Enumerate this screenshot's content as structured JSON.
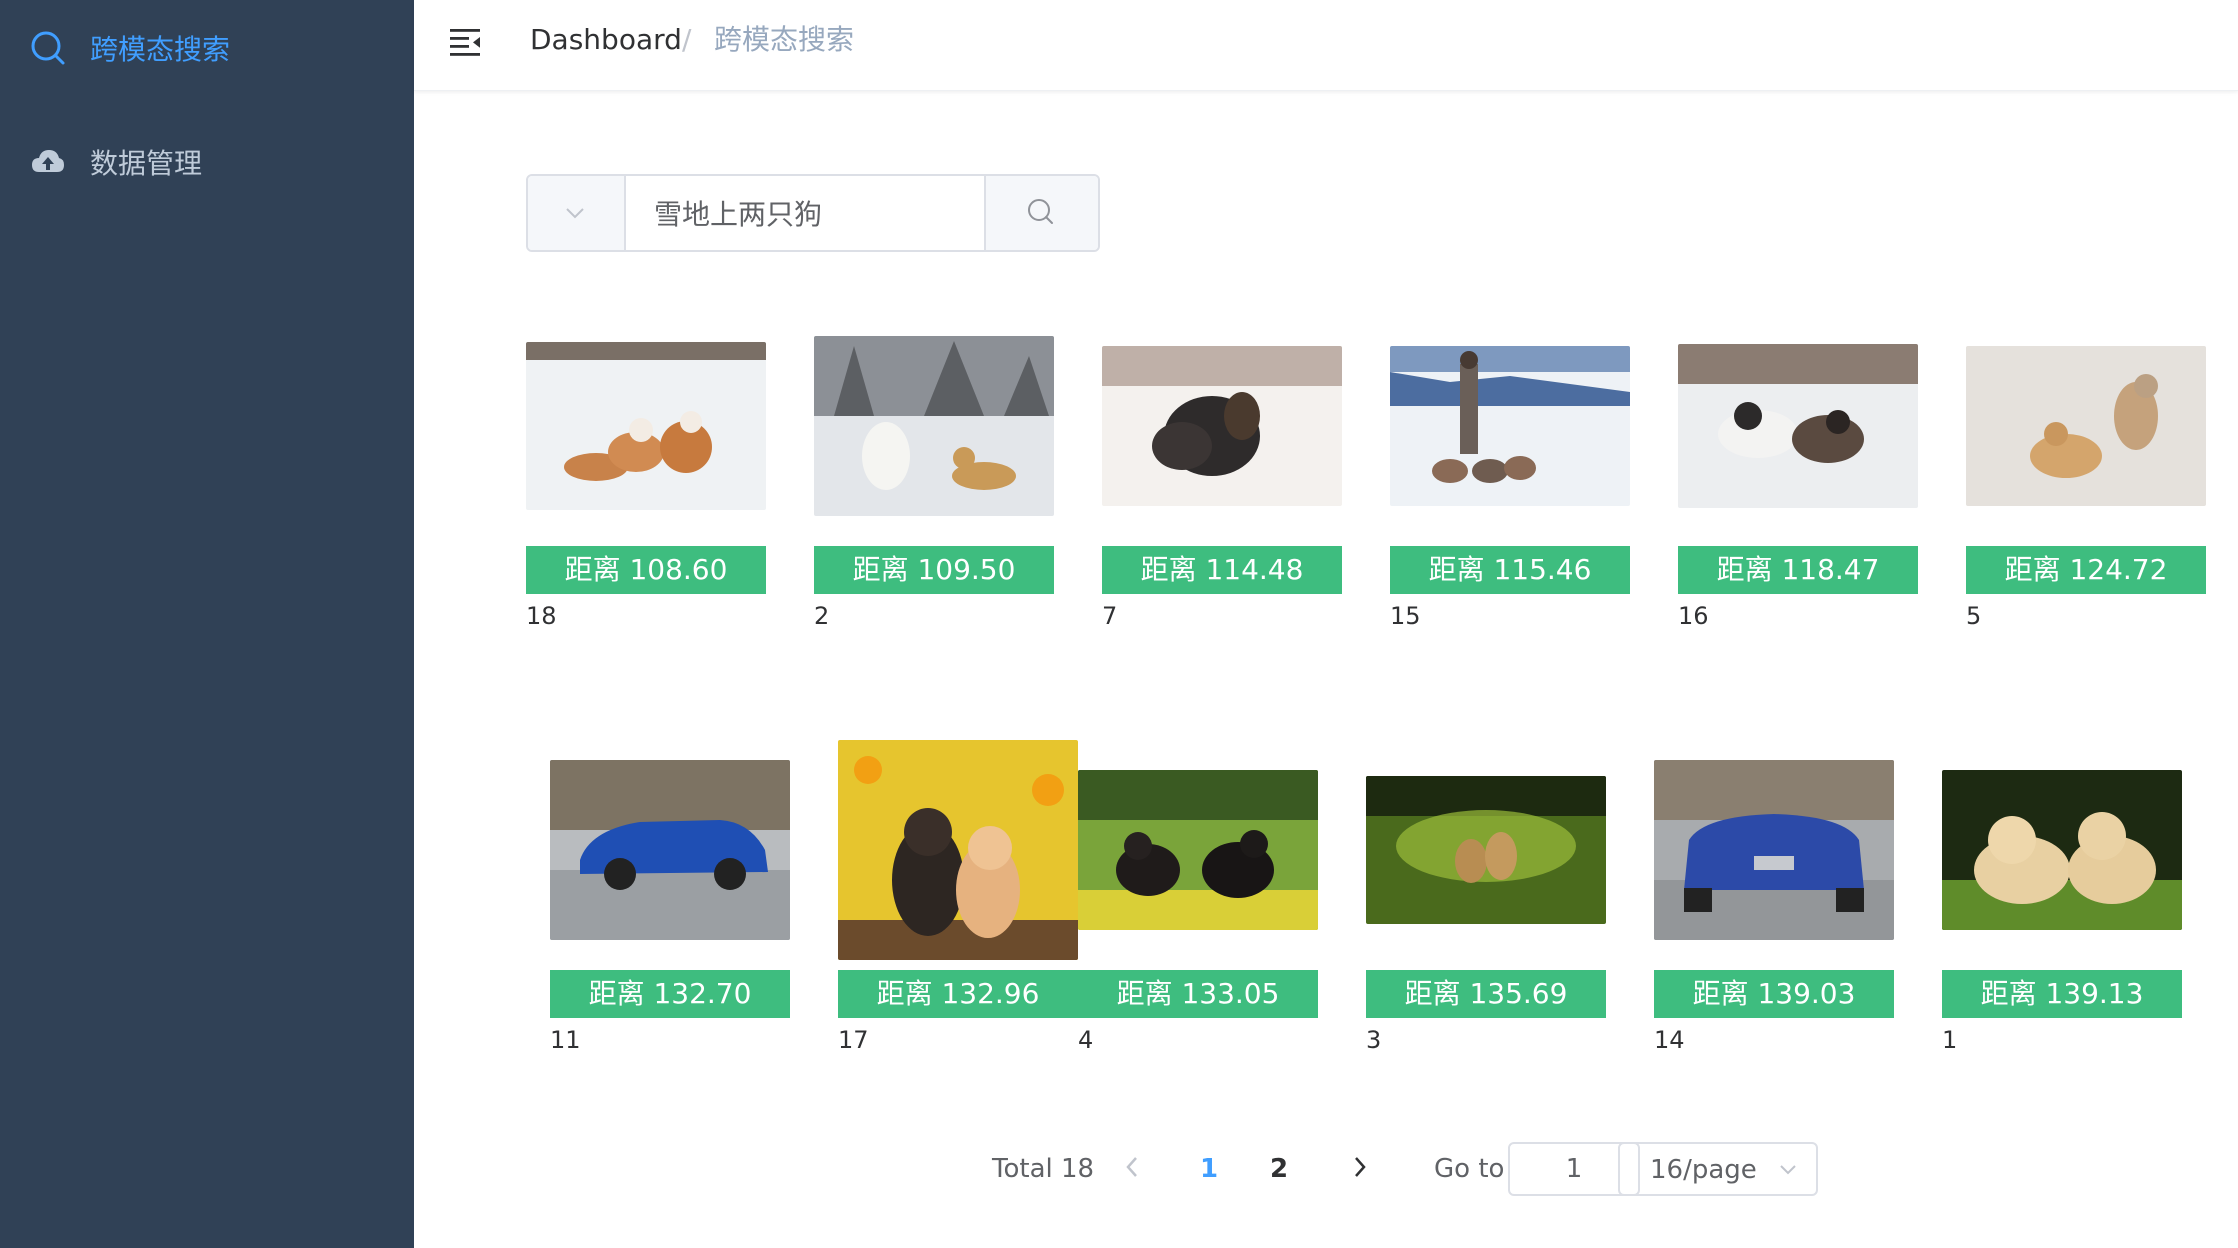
{
  "sidebar": {
    "items": [
      {
        "label": "跨模态搜索",
        "icon": "search-icon",
        "active": true
      },
      {
        "label": "数据管理",
        "icon": "cloud-upload-icon",
        "active": false
      }
    ]
  },
  "header": {
    "menu_icon": "hamburger-icon",
    "breadcrumb": [
      "Dashboard",
      "跨模态搜索"
    ],
    "separator": "/"
  },
  "search": {
    "query": "雪地上两只狗",
    "dropdown_icon": "chevron-down-icon",
    "button_icon": "search-icon"
  },
  "results": [
    {
      "distance": "距离 108.60",
      "id": "18",
      "scene": "two collies lying in snow"
    },
    {
      "distance": "距离 109.50",
      "id": "2",
      "scene": "white dog and golden retriever in snowy park"
    },
    {
      "distance": "距离 114.48",
      "id": "7",
      "scene": "two dark dogs in snow"
    },
    {
      "distance": "距离 115.46",
      "id": "15",
      "scene": "woman walking huskies on snow"
    },
    {
      "distance": "距离 118.47",
      "id": "16",
      "scene": "two dogs playing in snow"
    },
    {
      "distance": "距离 124.72",
      "id": "5",
      "scene": "dogs playing on snowy field"
    },
    {
      "distance": "距离 132.70",
      "id": "11",
      "scene": "blue SUV side view"
    },
    {
      "distance": "距离 132.96",
      "id": "17",
      "scene": "two shiba dogs in yellow flowers"
    },
    {
      "distance": "距离 133.05",
      "id": "4",
      "scene": "two dogs on green meadow"
    },
    {
      "distance": "距离 135.69",
      "id": "3",
      "scene": "two dogs in sunlit grass"
    },
    {
      "distance": "距离 139.03",
      "id": "14",
      "scene": "blue SUV front view"
    },
    {
      "distance": "距离 139.13",
      "id": "1",
      "scene": "two labrador puppies"
    }
  ],
  "pagination": {
    "total": "Total 18",
    "pages": [
      "1",
      "2"
    ],
    "current_page": "1",
    "goto_label": "Go to",
    "goto_value": "1",
    "page_size": "16/page"
  },
  "colors": {
    "sidebar_bg": "#304156",
    "accent": "#409eff",
    "badge": "#3ebd7f"
  }
}
